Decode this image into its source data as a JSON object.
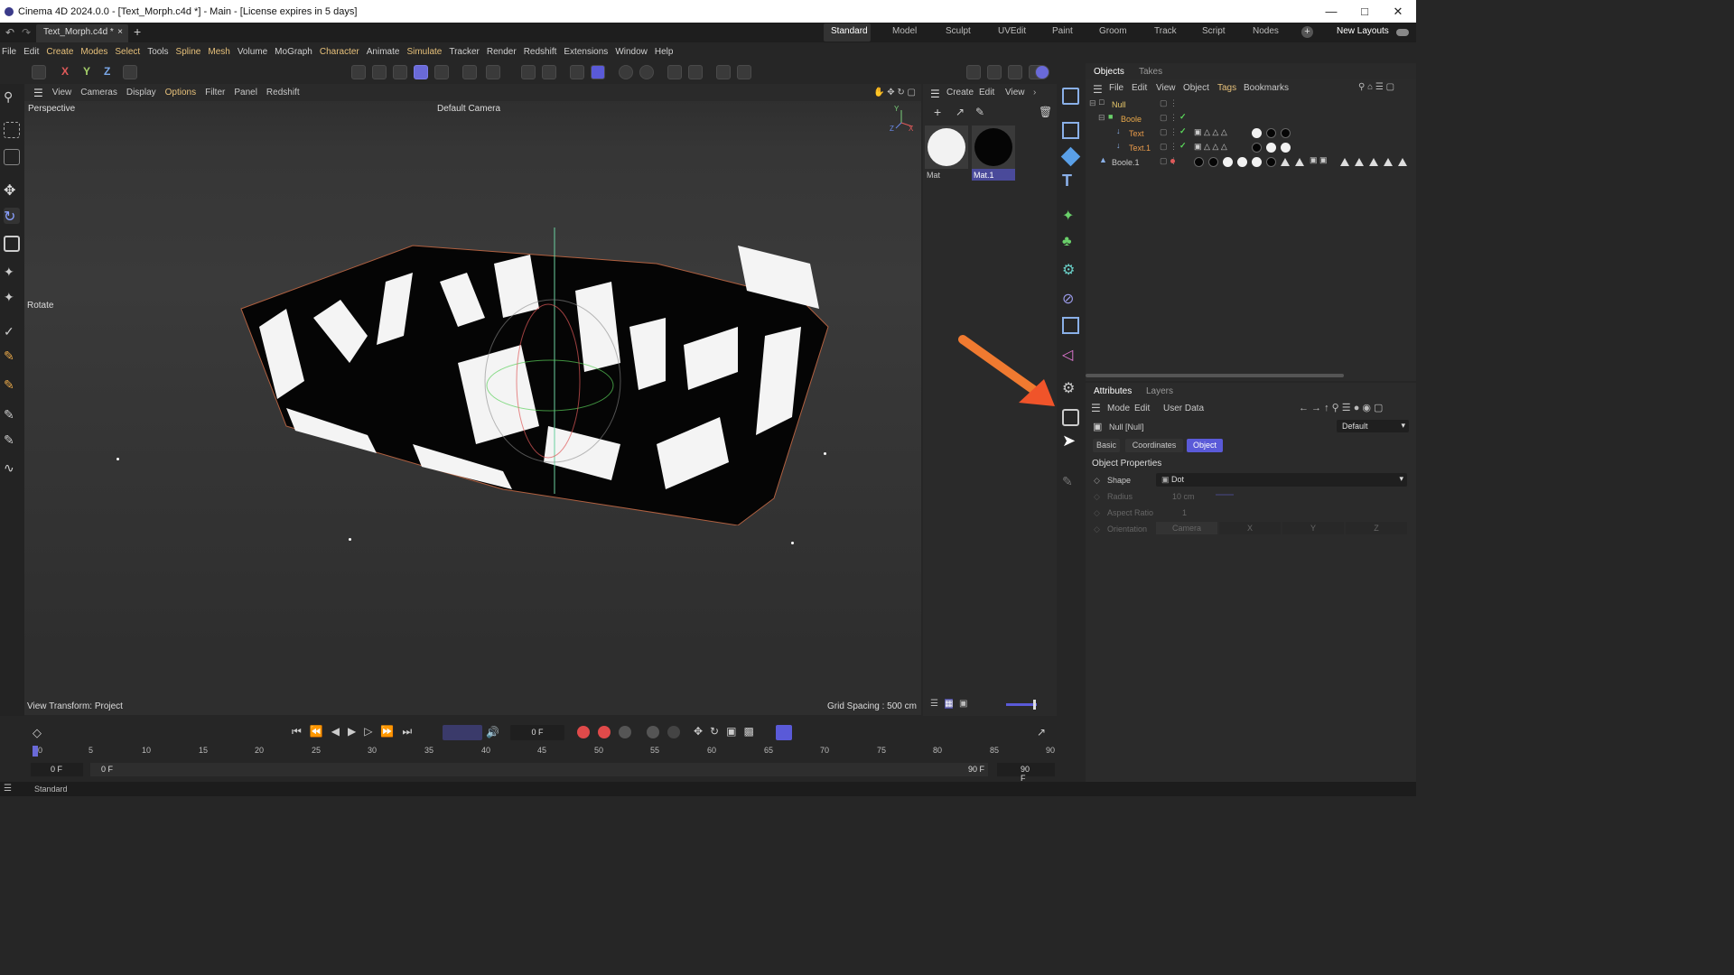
{
  "window": {
    "title": "Cinema 4D 2024.0.0 - [Text_Morph.c4d *] - Main - [License expires in 5 days]",
    "doc_tab": "Text_Morph.c4d *",
    "close_glyph": "×",
    "add_glyph": "+"
  },
  "layouts": [
    "Standard",
    "Model",
    "Sculpt",
    "UVEdit",
    "Paint",
    "Groom",
    "Track",
    "Script",
    "Nodes"
  ],
  "layouts_active": "Standard",
  "new_layouts": "New Layouts",
  "menu": [
    "File",
    "Edit",
    "Create",
    "Modes",
    "Select",
    "Tools",
    "Spline",
    "Mesh",
    "Volume",
    "MoGraph",
    "Character",
    "Animate",
    "Simulate",
    "Tracker",
    "Render",
    "Redshift",
    "Extensions",
    "Window",
    "Help"
  ],
  "axis_toggles": [
    "X",
    "Y",
    "Z"
  ],
  "viewport": {
    "menu": [
      "View",
      "Cameras",
      "Display",
      "Options",
      "Filter",
      "Panel",
      "Redshift"
    ],
    "menu_highlight": "Options",
    "name": "Perspective",
    "camera": "Default Camera",
    "rotate_label": "Rotate",
    "view_transform": "View Transform: Project",
    "grid_spacing": "Grid Spacing : 500 cm",
    "axis_y": "Y",
    "axis_x": "X",
    "axis_z": "Z"
  },
  "materials": {
    "menu": [
      "Create",
      "Edit",
      "View"
    ],
    "items": [
      {
        "name": "Mat",
        "color": "#f2f2f2"
      },
      {
        "name": "Mat.1",
        "color": "#050505"
      }
    ]
  },
  "objects_panel": {
    "tabs": [
      "Objects",
      "Takes"
    ],
    "menu": [
      "File",
      "Edit",
      "View",
      "Object",
      "Tags",
      "Bookmarks"
    ],
    "rows": [
      {
        "name": "Null",
        "color": "#e8c86a"
      },
      {
        "name": "Boole",
        "color": "#e8a84a"
      },
      {
        "name": "Text",
        "color": "#e89a4a"
      },
      {
        "name": "Text.1",
        "color": "#e89a4a"
      },
      {
        "name": "Boole.1",
        "color": "#c8c8c8"
      }
    ]
  },
  "attributes_panel": {
    "tabs": [
      "Attributes",
      "Layers"
    ],
    "menu": [
      "Mode",
      "Edit",
      "User Data"
    ],
    "object_name": "Null [Null]",
    "preset": "Default",
    "subtabs": [
      "Basic",
      "Coordinates",
      "Object"
    ],
    "active_subtab": "Object",
    "section_title": "Object Properties",
    "props": [
      {
        "label": "Shape",
        "value": "Dot"
      },
      {
        "label": "Radius",
        "value": "10 cm"
      },
      {
        "label": "Aspect Ratio",
        "value": "1"
      },
      {
        "label": "Orientation",
        "value": "Camera"
      }
    ],
    "orientation_axes": [
      "X",
      "Y",
      "Z"
    ]
  },
  "timeline": {
    "current_frame": "0 F",
    "ticks": [
      "0",
      "5",
      "10",
      "15",
      "20",
      "25",
      "30",
      "35",
      "40",
      "45",
      "50",
      "55",
      "60",
      "65",
      "70",
      "75",
      "80",
      "85",
      "90"
    ],
    "start_field": "0 F",
    "start_field2": "0 F",
    "end_field": "90 F",
    "end_field2": "90 F"
  },
  "status": "Standard",
  "colors": {
    "accent": "#5a5ad8",
    "highlight_text": "#e6c07a",
    "arrow": "#f07a30",
    "green_check": "#5ad85a"
  }
}
